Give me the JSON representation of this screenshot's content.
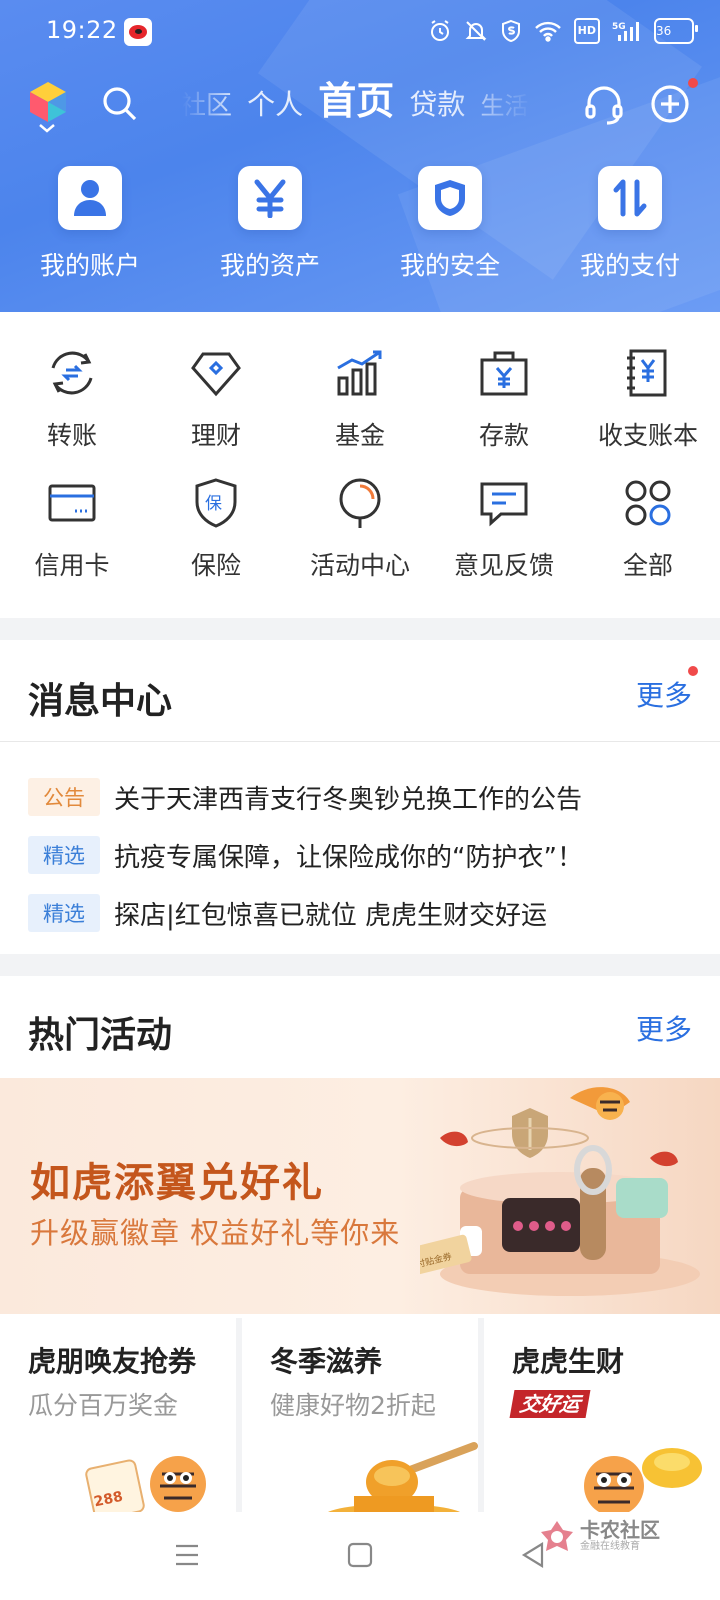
{
  "status_bar": {
    "time": "19:22",
    "signal": "5G",
    "hd": "HD",
    "battery": "36"
  },
  "top_nav": {
    "tabs": [
      "社区",
      "个人",
      "首页",
      "贷款",
      "生活"
    ],
    "active_tab": "首页"
  },
  "quick_actions": [
    {
      "label": "我的账户",
      "icon": "person-icon"
    },
    {
      "label": "我的资产",
      "icon": "yen-icon"
    },
    {
      "label": "我的安全",
      "icon": "shield-icon"
    },
    {
      "label": "我的支付",
      "icon": "transfer-arrows-icon"
    }
  ],
  "services": [
    {
      "label": "转账",
      "icon": "transfer-icon"
    },
    {
      "label": "理财",
      "icon": "diamond-icon"
    },
    {
      "label": "基金",
      "icon": "bar-chart-icon"
    },
    {
      "label": "存款",
      "icon": "deposit-box-icon"
    },
    {
      "label": "收支账本",
      "icon": "ledger-icon"
    },
    {
      "label": "信用卡",
      "icon": "credit-card-icon"
    },
    {
      "label": "保险",
      "icon": "insurance-shield-icon"
    },
    {
      "label": "活动中心",
      "icon": "balloon-icon"
    },
    {
      "label": "意见反馈",
      "icon": "feedback-icon"
    },
    {
      "label": "全部",
      "icon": "grid-icon"
    }
  ],
  "message_center": {
    "title": "消息中心",
    "more": "更多",
    "items": [
      {
        "tag": "公告",
        "text": "关于天津西青支行冬奥钞兑换工作的公告"
      },
      {
        "tag": "精选",
        "text": "抗疫专属保障，让保险成你的“防护衣”！"
      },
      {
        "tag": "精选",
        "text": "探店|红包惊喜已就位 虎虎生财交好运"
      }
    ]
  },
  "hot_activities": {
    "title": "热门活动",
    "more": "更多",
    "banner": {
      "title": "如虎添翼兑好礼",
      "subtitle": "升级赢徽章 权益好礼等你来",
      "coupon_text": "支付贴金券"
    },
    "promos": [
      {
        "title": "虎朋唤友抢券",
        "subtitle": "瓜分百万奖金",
        "badge_value": "288"
      },
      {
        "title": "冬季滋养",
        "subtitle": "健康好物2折起"
      },
      {
        "title": "虎虎生财",
        "badge": "交好运"
      }
    ]
  },
  "watermark": {
    "main": "卡农社区",
    "sub": "金融在线教育"
  },
  "colors": {
    "header_blue": "#5a8cf0",
    "link_blue": "#2a6fe0",
    "notice_orange": "#e28a3c",
    "banner_orange": "#c4561c",
    "red_dot": "#f04a4a"
  }
}
